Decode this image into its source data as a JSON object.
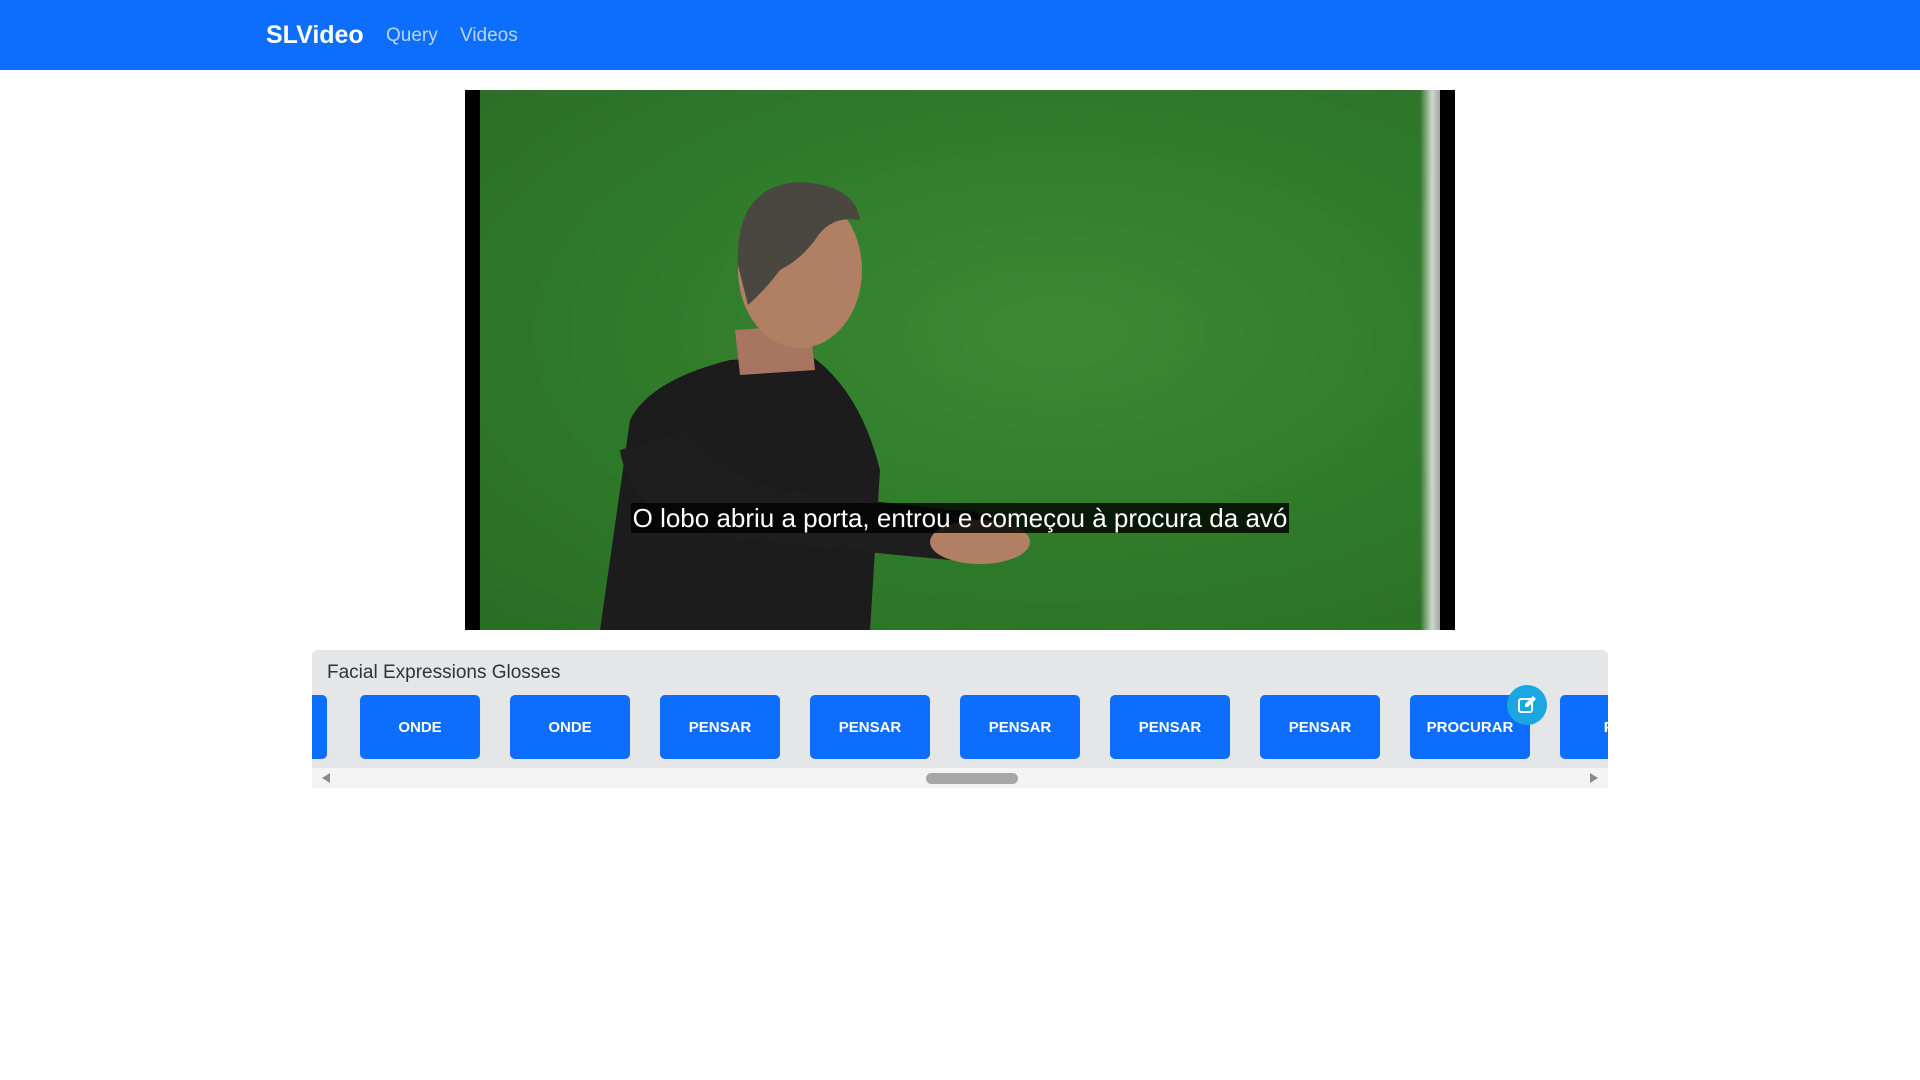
{
  "navbar": {
    "brand": "SLVideo",
    "links": [
      "Query",
      "Videos"
    ]
  },
  "video": {
    "subtitle": "O lobo abriu a porta, entrou e começou à procura da avó"
  },
  "glosses_panel": {
    "title": "Facial Expressions Glosses",
    "items": [
      "",
      "ONDE",
      "ONDE",
      "PENSAR",
      "PENSAR",
      "PENSAR",
      "PENSAR",
      "PENSAR",
      "PROCURAR",
      "PRO"
    ],
    "edit_icon": "edit-icon"
  },
  "colors": {
    "navbar": "#0d6efd",
    "gloss_button": "#0d6efd",
    "edit_badge": "#1aa6e0",
    "panel_bg": "#e5e6e8"
  }
}
